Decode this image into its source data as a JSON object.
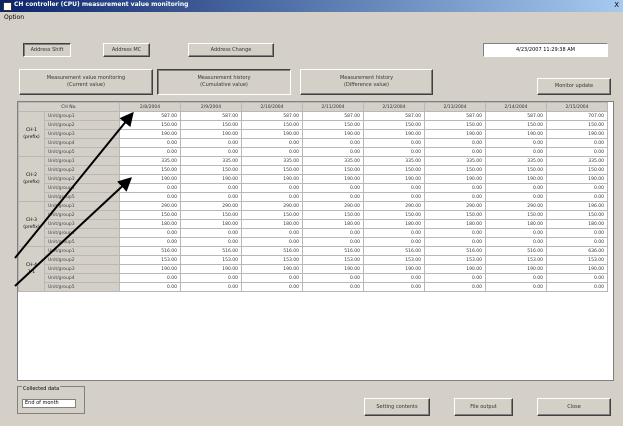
{
  "window": {
    "title": "CH controller (CPU) measurement value monitoring",
    "close": "X"
  },
  "menu": {
    "option": "Option"
  },
  "toolbar": {
    "address_shift": "Address Shift",
    "address_mc": "Address MC",
    "address_change": "Address Change",
    "datetime": "4/23/2007 11:29:38 AM"
  },
  "tabs": {
    "current": [
      "Measurement value monitoring",
      "(Current value)"
    ],
    "cumulative": [
      "Measurement history",
      "(Cumulative value)"
    ],
    "difference": [
      "Measurement history",
      "(Difference value)"
    ],
    "monitor_update": "Monitor update"
  },
  "table": {
    "ch_no_header": "CH No.",
    "dates": [
      "2/8/2004",
      "2/9/2004",
      "2/10/2004",
      "2/11/2004",
      "2/12/2004",
      "2/13/2004",
      "2/14/2004",
      "2/15/2004"
    ],
    "groups": [
      {
        "ch": [
          "CH-1",
          "(prefix)"
        ],
        "rows": [
          {
            "unit": "Unit/group1",
            "values": [
              "587.00",
              "587.00",
              "587.00",
              "587.00",
              "587.00",
              "587.00",
              "587.00",
              "707.00"
            ]
          },
          {
            "unit": "Unit/group2",
            "values": [
              "150.00",
              "150.00",
              "150.00",
              "150.00",
              "150.00",
              "150.00",
              "150.00",
              "150.00"
            ]
          },
          {
            "unit": "Unit/group3",
            "values": [
              "190.00",
              "190.00",
              "190.00",
              "190.00",
              "190.00",
              "190.00",
              "190.00",
              "190.00"
            ]
          },
          {
            "unit": "Unit/group4",
            "values": [
              "0.00",
              "0.00",
              "0.00",
              "0.00",
              "0.00",
              "0.00",
              "0.00",
              "0.00"
            ]
          },
          {
            "unit": "Unit/group5",
            "values": [
              "0.00",
              "0.00",
              "0.00",
              "0.00",
              "0.00",
              "0.00",
              "0.00",
              "0.00"
            ]
          }
        ]
      },
      {
        "ch": [
          "CH-2",
          "(prefix)"
        ],
        "rows": [
          {
            "unit": "Unit/group1",
            "values": [
              "335.00",
              "335.00",
              "335.00",
              "335.00",
              "335.00",
              "335.00",
              "335.00",
              "335.00"
            ]
          },
          {
            "unit": "Unit/group2",
            "values": [
              "150.00",
              "150.00",
              "150.00",
              "150.00",
              "150.00",
              "150.00",
              "150.00",
              "150.00"
            ]
          },
          {
            "unit": "Unit/group3",
            "values": [
              "190.00",
              "190.00",
              "190.00",
              "190.00",
              "190.00",
              "190.00",
              "190.00",
              "190.00"
            ]
          },
          {
            "unit": "Unit/group4",
            "values": [
              "0.00",
              "0.00",
              "0.00",
              "0.00",
              "0.00",
              "0.00",
              "0.00",
              "0.00"
            ]
          },
          {
            "unit": "Unit/group5",
            "values": [
              "0.00",
              "0.00",
              "0.00",
              "0.00",
              "0.00",
              "0.00",
              "0.00",
              "0.00"
            ]
          }
        ]
      },
      {
        "ch": [
          "CH-3",
          "(prefix)"
        ],
        "rows": [
          {
            "unit": "Unit/group1",
            "values": [
              "290.00",
              "290.00",
              "290.00",
              "290.00",
              "290.00",
              "290.00",
              "290.00",
              "196.00"
            ]
          },
          {
            "unit": "Unit/group2",
            "values": [
              "150.00",
              "150.00",
              "150.00",
              "150.00",
              "150.00",
              "150.00",
              "150.00",
              "150.00"
            ]
          },
          {
            "unit": "Unit/group3",
            "values": [
              "180.00",
              "180.00",
              "180.00",
              "180.00",
              "180.00",
              "180.00",
              "180.00",
              "180.00"
            ]
          },
          {
            "unit": "Unit/group4",
            "values": [
              "0.00",
              "0.00",
              "0.00",
              "0.00",
              "0.00",
              "0.00",
              "0.00",
              "0.00"
            ]
          },
          {
            "unit": "Unit/group5",
            "values": [
              "0.00",
              "0.00",
              "0.00",
              "0.00",
              "0.00",
              "0.00",
              "0.00",
              "0.00"
            ]
          }
        ]
      },
      {
        "ch": [
          "CH-4",
          "1-1"
        ],
        "rows": [
          {
            "unit": "Unit/group1",
            "values": [
              "516.00",
              "516.00",
              "516.00",
              "516.00",
              "516.00",
              "516.00",
              "516.00",
              "636.00"
            ]
          },
          {
            "unit": "Unit/group2",
            "values": [
              "153.00",
              "153.00",
              "153.00",
              "153.00",
              "153.00",
              "153.00",
              "153.00",
              "153.00"
            ]
          },
          {
            "unit": "Unit/group3",
            "values": [
              "190.00",
              "190.00",
              "190.00",
              "190.00",
              "190.00",
              "190.00",
              "190.00",
              "190.00"
            ]
          },
          {
            "unit": "Unit/group4",
            "values": [
              "0.00",
              "0.00",
              "0.00",
              "0.00",
              "0.00",
              "0.00",
              "0.00",
              "0.00"
            ]
          },
          {
            "unit": "Unit/group5",
            "values": [
              "0.00",
              "0.00",
              "0.00",
              "0.00",
              "0.00",
              "0.00",
              "0.00",
              "0.00"
            ]
          }
        ]
      }
    ]
  },
  "footer": {
    "collected_label": "Collected data",
    "collected_value": "End of month",
    "setting_contents": "Setting contents",
    "file_output": "File output",
    "close": "Close"
  }
}
